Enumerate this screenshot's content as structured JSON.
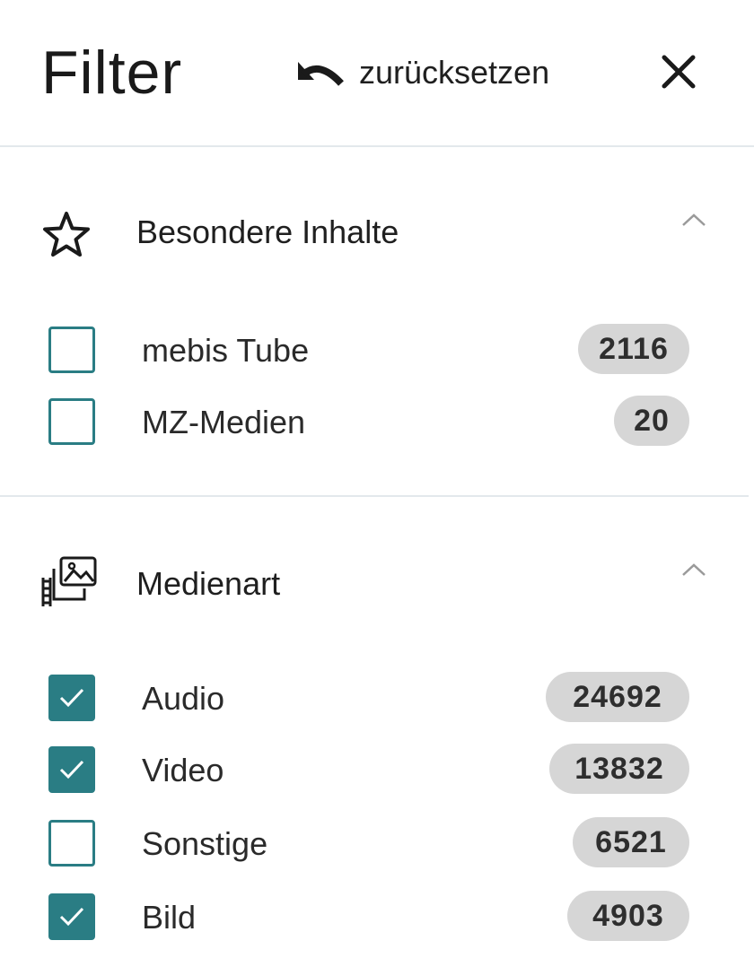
{
  "header": {
    "title": "Filter",
    "reset_label": "zurücksetzen"
  },
  "sections": [
    {
      "title": "Besondere Inhalte",
      "icon": "star-icon",
      "items": [
        {
          "label": "mebis Tube",
          "count": "2116",
          "checked": false
        },
        {
          "label": "MZ-Medien",
          "count": "20",
          "checked": false
        }
      ]
    },
    {
      "title": "Medienart",
      "icon": "media-type-icon",
      "items": [
        {
          "label": "Audio",
          "count": "24692",
          "checked": true
        },
        {
          "label": "Video",
          "count": "13832",
          "checked": true
        },
        {
          "label": "Sonstige",
          "count": "6521",
          "checked": false
        },
        {
          "label": "Bild",
          "count": "4903",
          "checked": true
        }
      ]
    }
  ],
  "colors": {
    "accent": "#2a7d84",
    "badge_bg": "#d6d6d6",
    "divider": "#e3e8ec"
  }
}
